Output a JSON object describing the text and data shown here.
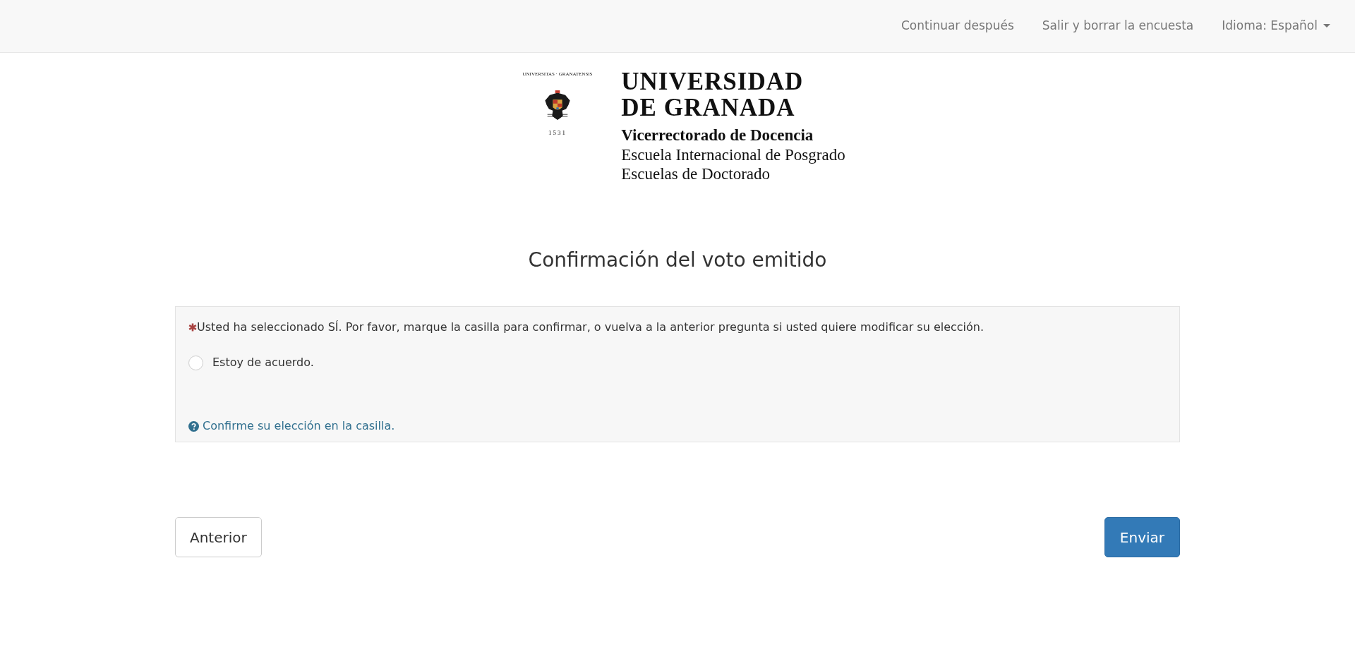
{
  "navbar": {
    "links": [
      {
        "label": "Continuar después",
        "kind": "link"
      },
      {
        "label": "Salir y borrar la encuesta",
        "kind": "link"
      },
      {
        "label": "Idioma: Español",
        "kind": "dropdown"
      }
    ]
  },
  "header": {
    "seal_ring": "UNIVERSITAS · GRANATENSIS",
    "seal_year": "1531",
    "university_line_1": "UNIVERSIDAD",
    "university_line_2": "DE GRANADA",
    "unit": "Vicerrectorado de Docencia",
    "subunits": [
      "Escuela Internacional de Posgrado",
      "Escuelas de Doctorado"
    ]
  },
  "title": "Confirmación del voto emitido",
  "question": {
    "required": true,
    "text": "Usted ha seleccionado SÍ. Por favor, marque la casilla para confirmar, o vuelva a la anterior pregunta si usted quiere modificar su elección.",
    "options": [
      {
        "label": "Estoy de acuerdo.",
        "selected": false
      }
    ],
    "help": "Confirme su elección en la casilla."
  },
  "buttons": [
    {
      "label": "Anterior",
      "kind": "secondary"
    },
    {
      "label": "Enviar",
      "kind": "primary"
    }
  ]
}
